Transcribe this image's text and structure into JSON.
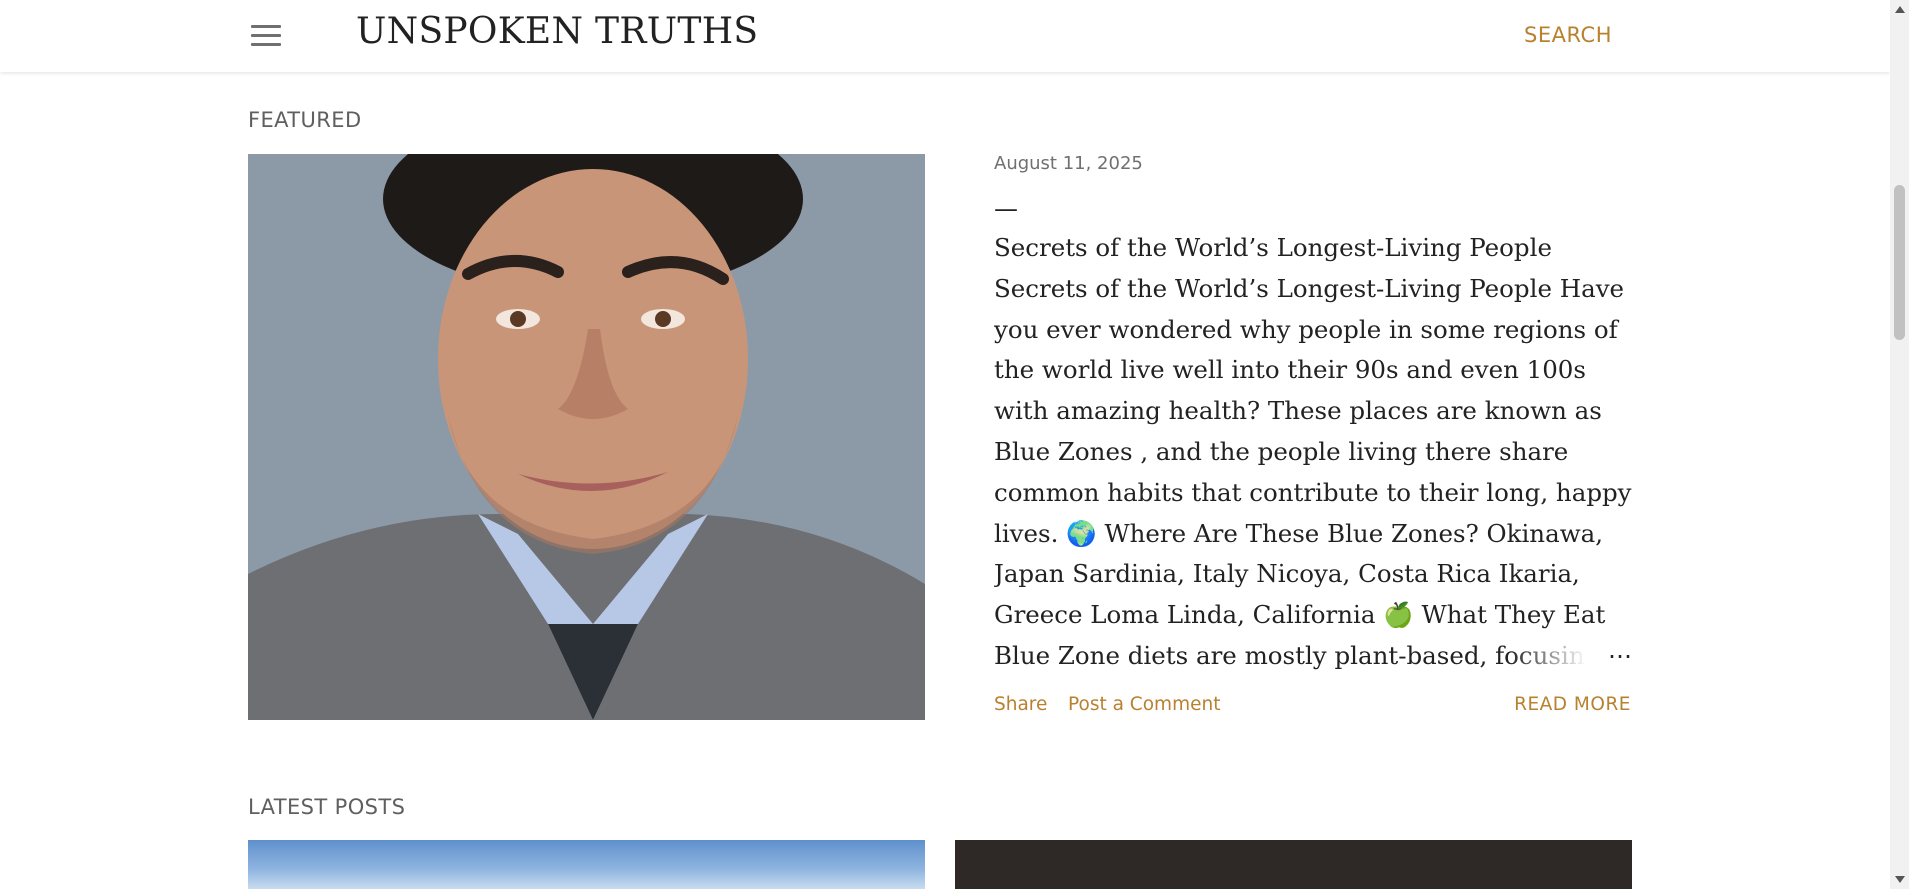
{
  "header": {
    "menu_icon": "hamburger-menu-icon",
    "site_title": "UNSPOKEN TRUTHS",
    "search_label": "SEARCH"
  },
  "featured": {
    "section_label": "FEATURED",
    "image_alt": "",
    "date": "August 11, 2025",
    "dash": "—",
    "snippet": "Secrets of the World’s Longest-Living People Secrets of the World’s Longest-Living People Have you ever wondered why people in some regions of the world live well into their 90s and even 100s with amazing health? These places are known as Blue Zones , and the people living there share common habits that contribute to their long, happy lives. 🌍 Where Are These Blue Zones? Okinawa, Japan Sardinia, Italy Nicoya, Costa Rica Ikaria, Greece Loma Linda, California 🍏 What They Eat Blue Zone diets are mostly plant-based, focusing on fresh vegetables, beans, whole grains, and nuts. Meat is eate",
    "ellipsis": "…",
    "share_label": "Share",
    "comment_label": "Post a Comment",
    "read_more_label": "READ MORE"
  },
  "latest": {
    "section_label": "LATEST POSTS"
  },
  "colors": {
    "accent": "#b8812f",
    "text": "#222222",
    "muted": "#707070"
  }
}
